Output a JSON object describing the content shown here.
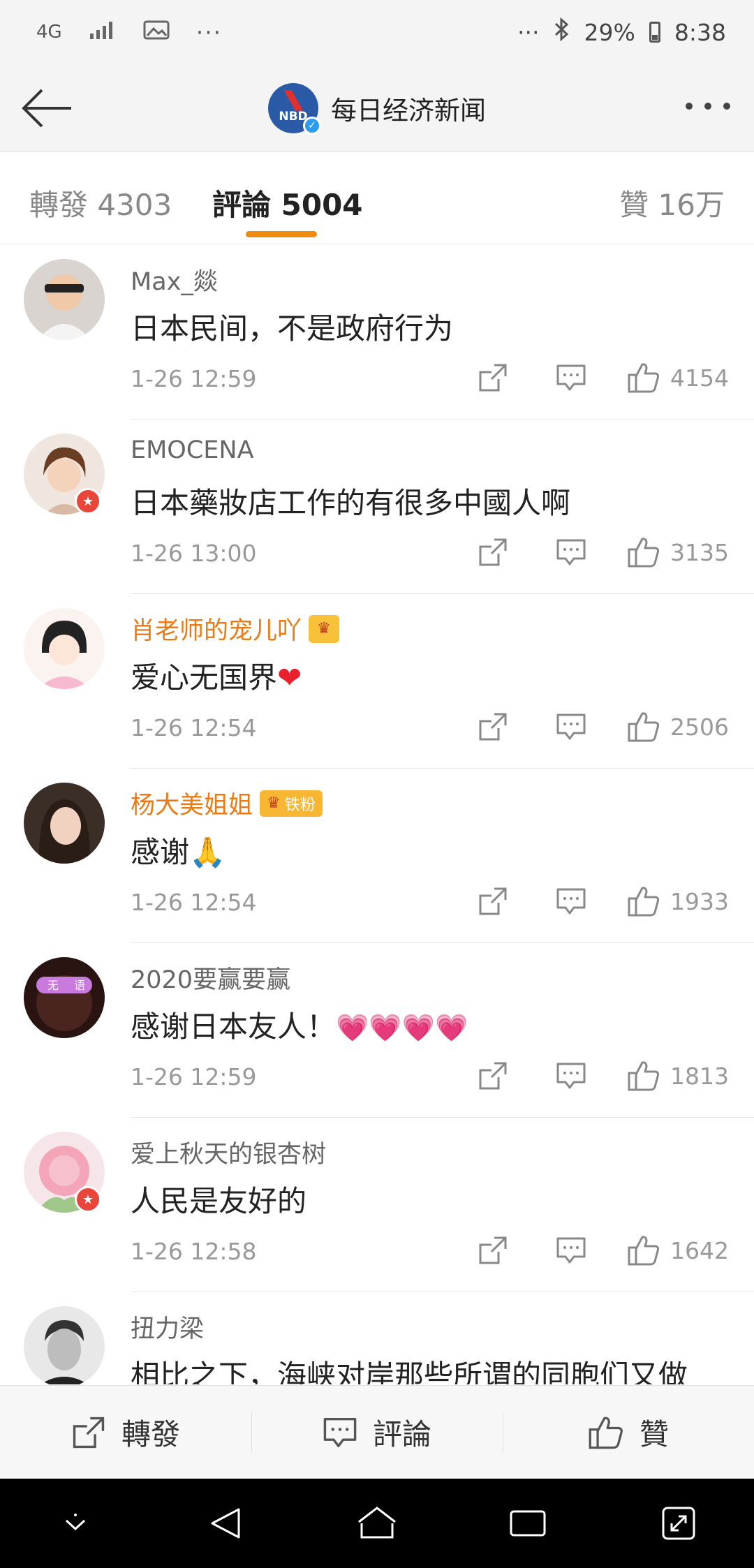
{
  "status_bar": {
    "network": "4G",
    "battery_percent": "29%",
    "time": "8:38"
  },
  "header": {
    "title": "每日经济新闻",
    "logo_text": "NBD"
  },
  "tabs": {
    "repost": "轉發 4303",
    "comments": "評論 5004",
    "likes": "贊 16万"
  },
  "comments": [
    {
      "user": "Max_燚",
      "text": "日本民间，不是政府行为",
      "time": "1-26 12:59",
      "likes": "4154"
    },
    {
      "user": "EMOCENA",
      "text": "日本藥妝店工作的有很多中國人啊",
      "time": "1-26 13:00",
      "likes": "3135"
    },
    {
      "user": "肖老师的宠儿吖",
      "text": "爱心无国界",
      "time": "1-26 12:54",
      "likes": "2506"
    },
    {
      "user": "杨大美姐姐",
      "text": "感谢",
      "time": "1-26 12:54",
      "likes": "1933",
      "fan_badge": "铁粉"
    },
    {
      "user": "2020要赢要赢",
      "text": "感谢日本友人！",
      "time": "1-26 12:59",
      "likes": "1813",
      "avatar_text_left": "无",
      "avatar_text_right": "语"
    },
    {
      "user": "爱上秋天的银杏树",
      "text": "人民是友好的",
      "time": "1-26 12:58",
      "likes": "1642"
    },
    {
      "user": "扭力梁",
      "text": "相比之下，海峡对岸那些所谓的同胞们又做"
    }
  ],
  "bottom_bar": {
    "repost": "轉發",
    "comment": "評論",
    "like": "贊"
  },
  "colors": {
    "accent_orange": "#f28c0e",
    "vip_name": "#eb7a13",
    "verify_blue": "#2d9cf0"
  }
}
